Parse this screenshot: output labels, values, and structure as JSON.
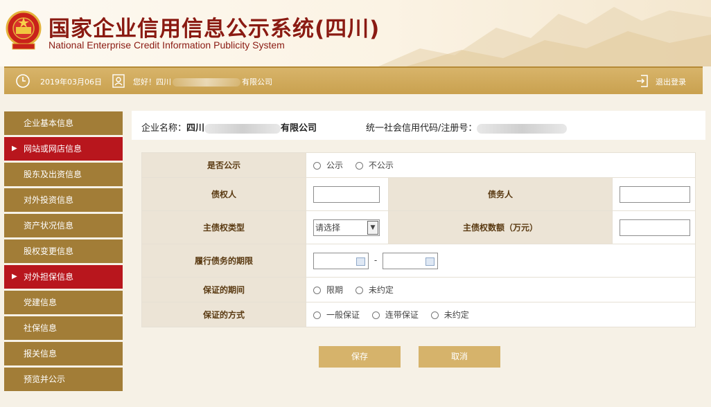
{
  "header": {
    "title_cn": "国家企业信用信息公示系统(四川)",
    "title_en": "National Enterprise Credit Information Publicity System"
  },
  "toolbar": {
    "date": "2019年03月06日",
    "greeting_prefix": "您好！四川",
    "greeting_suffix": "有限公司",
    "logout": "退出登录",
    "icons": [
      "clock-icon",
      "user-icon",
      "logout-icon"
    ]
  },
  "sidebar": {
    "items": [
      {
        "label": "企业基本信息",
        "active": false
      },
      {
        "label": "网站或网店信息",
        "active": true
      },
      {
        "label": "股东及出资信息",
        "active": false
      },
      {
        "label": "对外投资信息",
        "active": false
      },
      {
        "label": "资产状况信息",
        "active": false
      },
      {
        "label": "股权变更信息",
        "active": false
      },
      {
        "label": "对外担保信息",
        "active": true
      },
      {
        "label": "党建信息",
        "active": false
      },
      {
        "label": "社保信息",
        "active": false
      },
      {
        "label": "报关信息",
        "active": false
      },
      {
        "label": "预览并公示",
        "active": false
      }
    ]
  },
  "company": {
    "name_label": "企业名称：",
    "name_prefix": "四川",
    "name_suffix": "有限公司",
    "code_label": "统一社会信用代码/注册号："
  },
  "form": {
    "publicize_label": "是否公示",
    "publicize_opts": [
      "公示",
      "不公示"
    ],
    "creditor_label": "债权人",
    "debtor_label": "债务人",
    "claim_type_label": "主债权类型",
    "claim_type_value": "请选择",
    "claim_amount_label": "主债权数额（万元）",
    "term_label": "履行债务的期限",
    "term_sep": "-",
    "guarantee_period_label": "保证的期间",
    "guarantee_period_opts": [
      "限期",
      "未约定"
    ],
    "guarantee_mode_label": "保证的方式",
    "guarantee_mode_opts": [
      "一般保证",
      "连带保证",
      "未约定"
    ]
  },
  "buttons": {
    "save": "保存",
    "cancel": "取消"
  },
  "colors": {
    "brand_red": "#8a1a12",
    "gold": "#c9a14f",
    "sidebar": "#a27d37",
    "active": "#b8161d"
  }
}
